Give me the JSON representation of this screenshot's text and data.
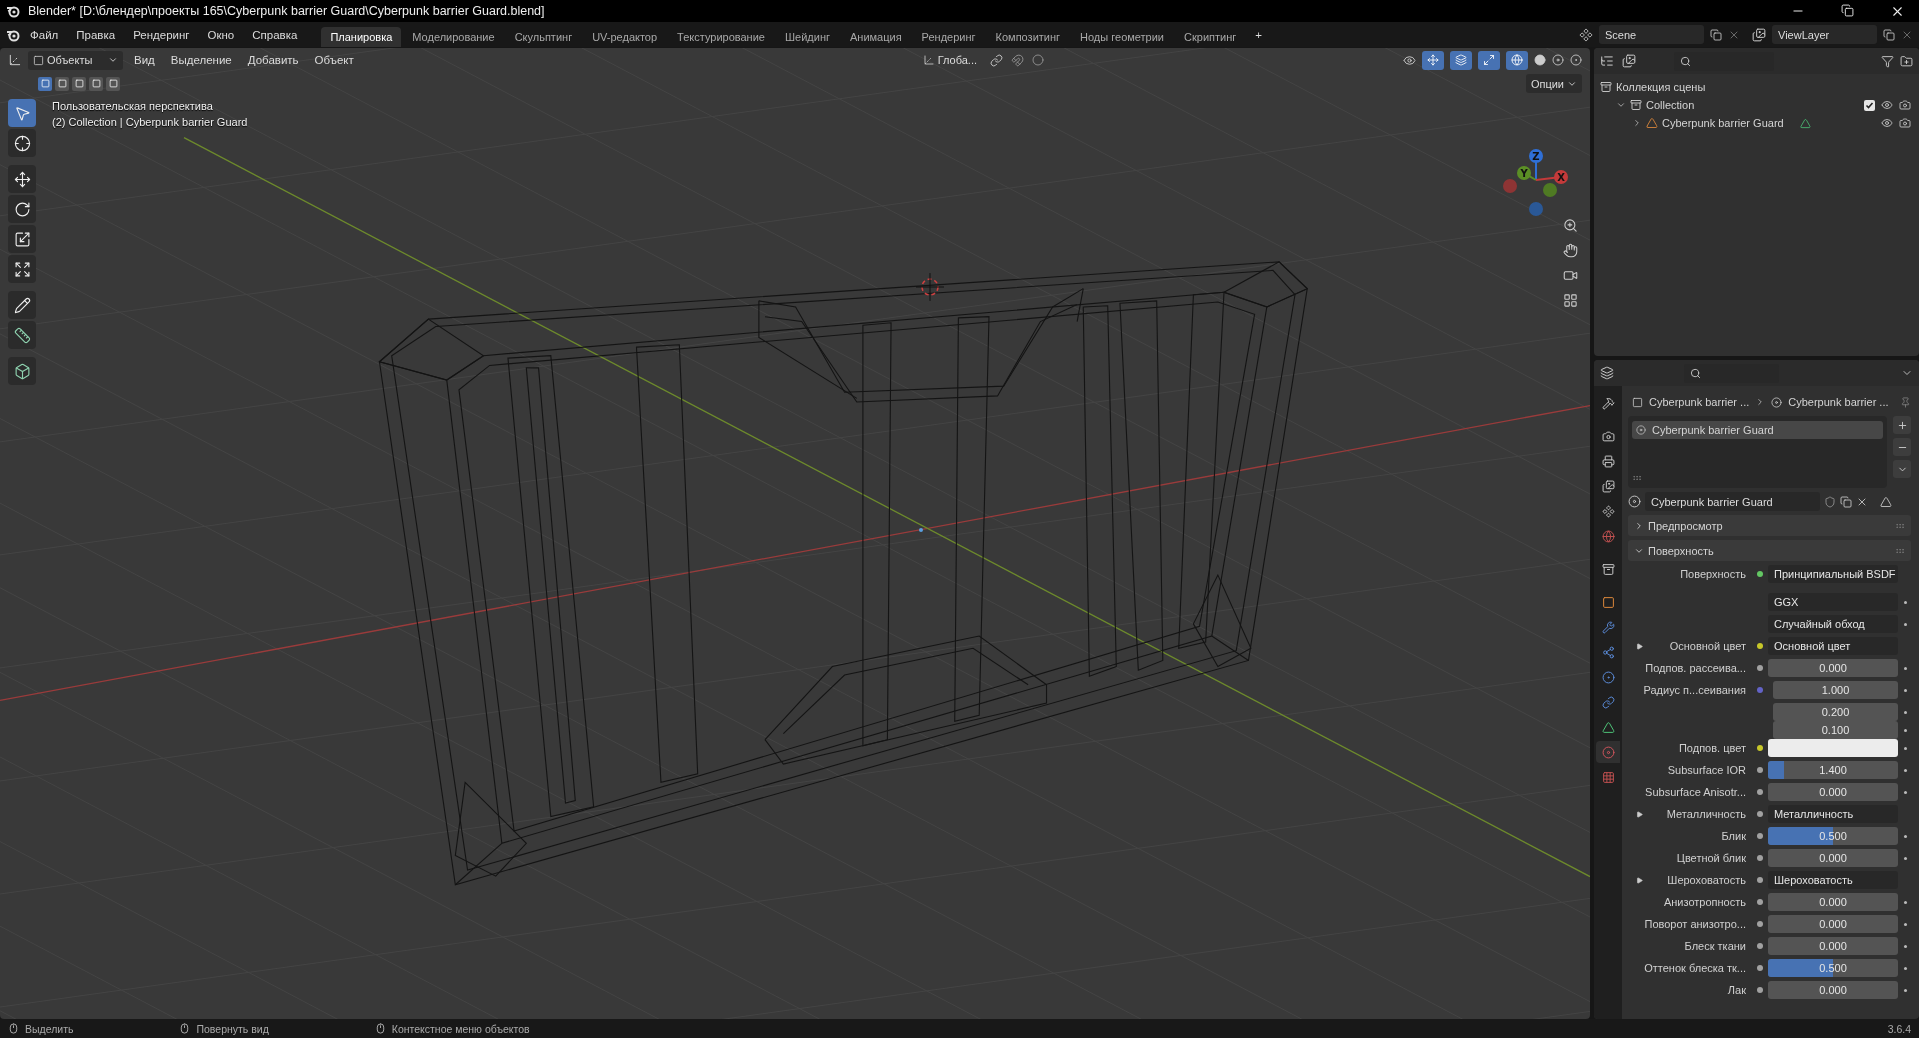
{
  "window": {
    "title": "Blender* [D:\\блендер\\проекты 165\\Cyberpunk barrier Guard\\Cyberpunk barrier Guard.blend]"
  },
  "menu": [
    "Файл",
    "Правка",
    "Рендеринг",
    "Окно",
    "Справка"
  ],
  "workspaces": [
    {
      "label": "Планировка",
      "selected": true
    },
    {
      "label": "Моделирование",
      "selected": false
    },
    {
      "label": "Скульптинг",
      "selected": false
    },
    {
      "label": "UV-редактор",
      "selected": false
    },
    {
      "label": "Текстурирование",
      "selected": false
    },
    {
      "label": "Шейдинг",
      "selected": false
    },
    {
      "label": "Анимация",
      "selected": false
    },
    {
      "label": "Рендеринг",
      "selected": false
    },
    {
      "label": "Композитинг",
      "selected": false
    },
    {
      "label": "Ноды геометрии",
      "selected": false
    },
    {
      "label": "Скриптинг",
      "selected": false
    }
  ],
  "add_workspace": "+",
  "scene": "Scene",
  "view_layer": "ViewLayer",
  "viewport": {
    "mode": "Объекты",
    "menus": [
      "Вид",
      "Выделение",
      "Добавить",
      "Объект"
    ],
    "orientation": "Глоба...",
    "options": "Опции",
    "select_modes": [
      {
        "selected": true
      },
      {
        "selected": false
      },
      {
        "selected": false
      },
      {
        "selected": false
      },
      {
        "selected": false
      }
    ],
    "tools": [
      {
        "kind": "select",
        "selected": true
      },
      {
        "kind": "cursor",
        "selected": false
      },
      {
        "kind": "move",
        "selected": false
      },
      {
        "kind": "rotate",
        "selected": false
      },
      {
        "kind": "scale",
        "selected": false
      },
      {
        "kind": "transform",
        "selected": false
      },
      {
        "kind": "annotate",
        "selected": false
      },
      {
        "kind": "measure",
        "selected": false
      },
      {
        "kind": "add-cube",
        "selected": false
      }
    ],
    "view_name": "Пользовательская перспектива",
    "object_info": "(2) Collection | Cyberpunk barrier Guard",
    "gizmo_axes": [
      "Z",
      "Y",
      "X"
    ]
  },
  "outliner": {
    "tree": [
      {
        "label": "Коллекция сцены",
        "kind": "scene-collection",
        "children": [
          {
            "label": "Collection",
            "kind": "collection",
            "expanded": true,
            "checked": true,
            "children": [
              {
                "label": "Cyberpunk barrier Guard",
                "kind": "mesh-object",
                "expanded": false
              }
            ]
          }
        ]
      }
    ]
  },
  "properties": {
    "tabs": [
      {
        "kind": "tool",
        "selected": false
      },
      {
        "kind": "render",
        "selected": false
      },
      {
        "kind": "output",
        "selected": false
      },
      {
        "kind": "view-layer",
        "selected": false
      },
      {
        "kind": "scene",
        "selected": false
      },
      {
        "kind": "world",
        "selected": false
      },
      {
        "kind": "collection",
        "selected": false
      },
      {
        "kind": "object",
        "selected": false
      },
      {
        "kind": "modifiers",
        "selected": false
      },
      {
        "kind": "particles",
        "selected": false
      },
      {
        "kind": "physics",
        "selected": false
      },
      {
        "kind": "constraints",
        "selected": false
      },
      {
        "kind": "data",
        "selected": false
      },
      {
        "kind": "material",
        "selected": true
      },
      {
        "kind": "texture",
        "selected": false
      }
    ],
    "breadcrumb": [
      "Cyberpunk barrier ...",
      "Cyberpunk barrier ..."
    ],
    "material_slots": [
      {
        "label": "Cyberpunk barrier Guard",
        "selected": true
      }
    ],
    "material_name": "Cyberpunk barrier Guard",
    "panels": [
      {
        "label": "Предпросмотр",
        "expanded": false
      },
      {
        "label": "Поверхность",
        "expanded": true,
        "rows": [
          {
            "kind": "link",
            "label": "Поверхность",
            "value": "Принципиальный BSDF",
            "socket": {
              "color": "#63c763"
            },
            "expandable": false
          },
          {
            "kind": "dropdown",
            "value": "GGX"
          },
          {
            "kind": "dropdown",
            "value": "Случайный обход"
          },
          {
            "kind": "link",
            "label": "Основной цвет",
            "value": "Основной цвет",
            "socket": {
              "color": "#c7c729"
            },
            "expandable": true
          },
          {
            "kind": "slider",
            "label": "Подпов. рассеива...",
            "value": "0.000",
            "level": 0,
            "socket": {
              "color": "#a1a1a1"
            }
          },
          {
            "kind": "vector",
            "label": "Радиус п...сеивания",
            "values": [
              "1.000",
              "0.200",
              "0.100"
            ],
            "socket": {
              "color": "#6363c7"
            }
          },
          {
            "kind": "swatch",
            "label": "Подпов. цвет",
            "color": "#ececec",
            "socket": {
              "color": "#c7c729"
            }
          },
          {
            "kind": "slider",
            "label": "Subsurface IOR",
            "value": "1.400",
            "level": 0.12,
            "socket": {
              "color": "#a1a1a1"
            }
          },
          {
            "kind": "slider",
            "label": "Subsurface Anisotr...",
            "value": "0.000",
            "level": 0,
            "socket": {
              "color": "#a1a1a1"
            }
          },
          {
            "kind": "link",
            "label": "Металличность",
            "value": "Металличность",
            "socket": {
              "color": "#a1a1a1"
            },
            "expandable": true
          },
          {
            "kind": "slider",
            "label": "Блик",
            "value": "0.500",
            "level": 0.5,
            "socket": {
              "color": "#a1a1a1"
            }
          },
          {
            "kind": "slider",
            "label": "Цветной блик",
            "value": "0.000",
            "level": 0,
            "socket": {
              "color": "#a1a1a1"
            }
          },
          {
            "kind": "link",
            "label": "Шероховатость",
            "value": "Шероховатость",
            "socket": {
              "color": "#a1a1a1"
            },
            "expandable": true
          },
          {
            "kind": "slider",
            "label": "Анизотропность",
            "value": "0.000",
            "level": 0,
            "socket": {
              "color": "#a1a1a1"
            }
          },
          {
            "kind": "slider",
            "label": "Поворот анизотро...",
            "value": "0.000",
            "level": 0,
            "socket": {
              "color": "#a1a1a1"
            }
          },
          {
            "kind": "slider",
            "label": "Блеск ткани",
            "value": "0.000",
            "level": 0,
            "socket": {
              "color": "#a1a1a1"
            }
          },
          {
            "kind": "slider",
            "label": "Оттенок блеска тк...",
            "value": "0.500",
            "level": 0.5,
            "socket": {
              "color": "#a1a1a1"
            }
          },
          {
            "kind": "slider",
            "label": "Лак",
            "value": "0.000",
            "level": 0,
            "socket": {
              "color": "#a1a1a1"
            }
          }
        ]
      }
    ]
  },
  "status_bar": {
    "hints": [
      "Выделить",
      "Повернуть вид",
      "Контекстное меню объектов"
    ],
    "version": "3.6.4"
  }
}
